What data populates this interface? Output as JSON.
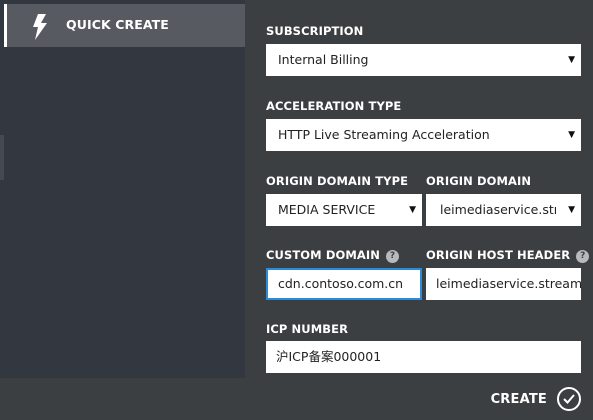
{
  "sidebar": {
    "items": [
      {
        "label": "QUICK CREATE",
        "icon": "lightning-icon"
      }
    ]
  },
  "form": {
    "subscription": {
      "label": "SUBSCRIPTION",
      "value": "Internal Billing"
    },
    "acceleration_type": {
      "label": "ACCELERATION TYPE",
      "value": "HTTP Live Streaming Acceleration"
    },
    "origin_domain_type": {
      "label": "ORIGIN DOMAIN TYPE",
      "value": "MEDIA SERVICE"
    },
    "origin_domain": {
      "label": "ORIGIN DOMAIN",
      "value": "leimediaservice.streaming.mediaservices.chinacloudapi.cn"
    },
    "custom_domain": {
      "label": "CUSTOM DOMAIN",
      "value": "cdn.contoso.com.cn",
      "help": "?"
    },
    "origin_host_header": {
      "label": "ORIGIN HOST HEADER",
      "value": "leimediaservice.streaming.mediaservices.chinacloudapi.cn",
      "help": "?"
    },
    "icp_number": {
      "label": "ICP NUMBER",
      "value": "沪ICP备案000001"
    }
  },
  "footer": {
    "create_label": "CREATE",
    "create_icon": "checkmark-icon"
  },
  "colors": {
    "background": "#3c3f41",
    "sidebar": "#333740",
    "selected_item": "#575a61",
    "focus_border": "#2b8bdb"
  }
}
